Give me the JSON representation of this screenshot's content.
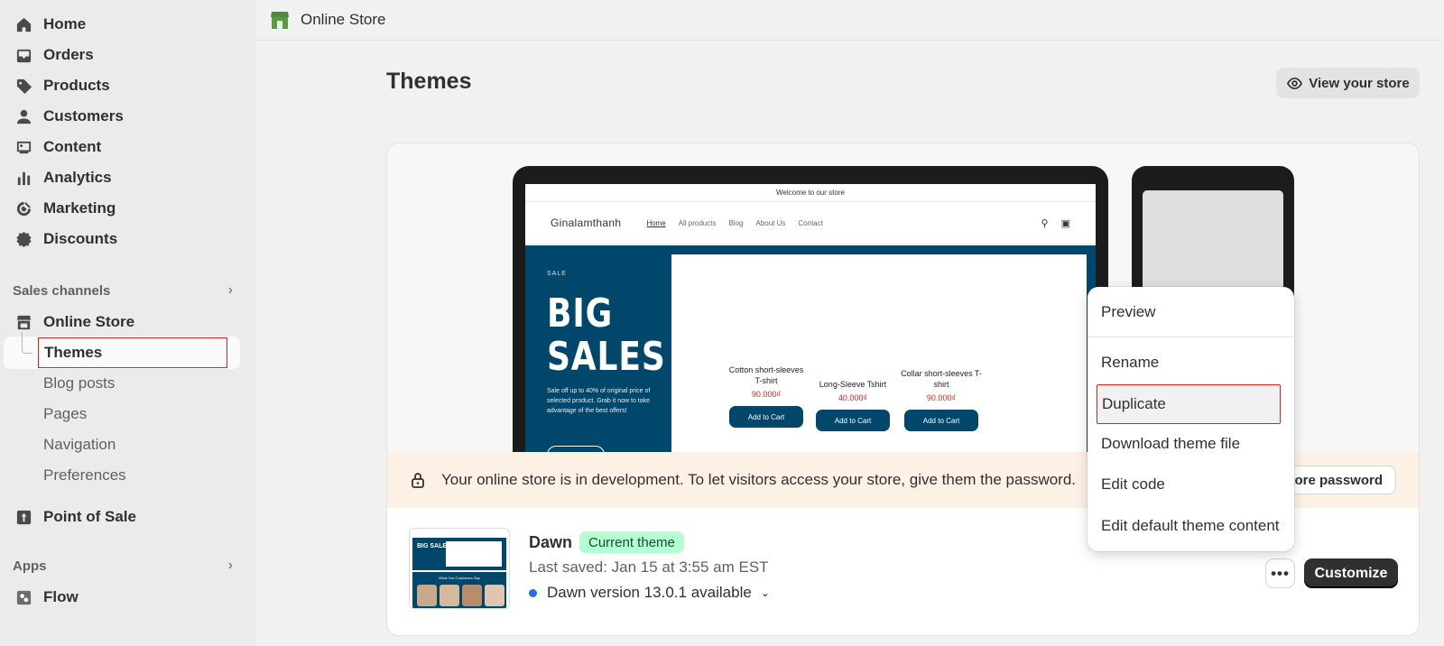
{
  "sidebar": {
    "nav": [
      {
        "label": "Home",
        "icon": "home-icon"
      },
      {
        "label": "Orders",
        "icon": "inbox-icon"
      },
      {
        "label": "Products",
        "icon": "tag-icon"
      },
      {
        "label": "Customers",
        "icon": "person-icon"
      },
      {
        "label": "Content",
        "icon": "image-icon"
      },
      {
        "label": "Analytics",
        "icon": "bar-chart-icon"
      },
      {
        "label": "Marketing",
        "icon": "target-icon"
      },
      {
        "label": "Discounts",
        "icon": "discount-icon"
      }
    ],
    "sales_channels_label": "Sales channels",
    "online_store_label": "Online Store",
    "online_store_sub": [
      "Themes",
      "Blog posts",
      "Pages",
      "Navigation",
      "Preferences"
    ],
    "point_of_sale_label": "Point of Sale",
    "apps_label": "Apps",
    "flow_label": "Flow"
  },
  "topbar": {
    "title": "Online Store"
  },
  "page": {
    "title": "Themes",
    "view_store_label": "View your store"
  },
  "preview": {
    "announcement": "Welcome to our store",
    "store_logo": "Ginalamthanh",
    "store_nav": [
      "Home",
      "All products",
      "Blog",
      "About Us",
      "Contact"
    ],
    "hero_kicker": "SALE",
    "hero_title_1": "BIG",
    "hero_title_2": "SALES",
    "hero_desc": "Sale off up to 40% of original price of selected product. Grab it now to take advantage of the best offers!",
    "products": [
      {
        "name": "Cotton short-sleeves T-shirt",
        "price": "90.000₫",
        "button": "Add to Cart"
      },
      {
        "name": "Long-Sleeve Tshirt",
        "price": "40.000₫",
        "button": "Add to Cart"
      },
      {
        "name": "Collar short-sleeves T-shirt",
        "price": "90.000₫",
        "button": "Add to Cart"
      }
    ]
  },
  "banner": {
    "text": "Your online store is in development. To let visitors access your store, give them the password.",
    "password_button": "tore password"
  },
  "theme": {
    "name": "Dawn",
    "badge": "Current theme",
    "last_saved": "Last saved: Jan 15 at 3:55 am EST",
    "version": "Dawn version 13.0.1 available",
    "more_label": "•••",
    "customize_label": "Customize",
    "thumb_title": "BIG SALES",
    "thumb_caption": "What Our Customers Say"
  },
  "menu": {
    "items": [
      "Preview",
      "Rename",
      "Duplicate",
      "Download theme file",
      "Edit code",
      "Edit default theme content"
    ],
    "highlighted": "Duplicate"
  },
  "colors": {
    "accent_red": "#e02020",
    "hero_blue": "#00476b",
    "badge_green": "#b4fed2",
    "banner_bg": "#fdf1e6",
    "price_red": "#e02424"
  }
}
